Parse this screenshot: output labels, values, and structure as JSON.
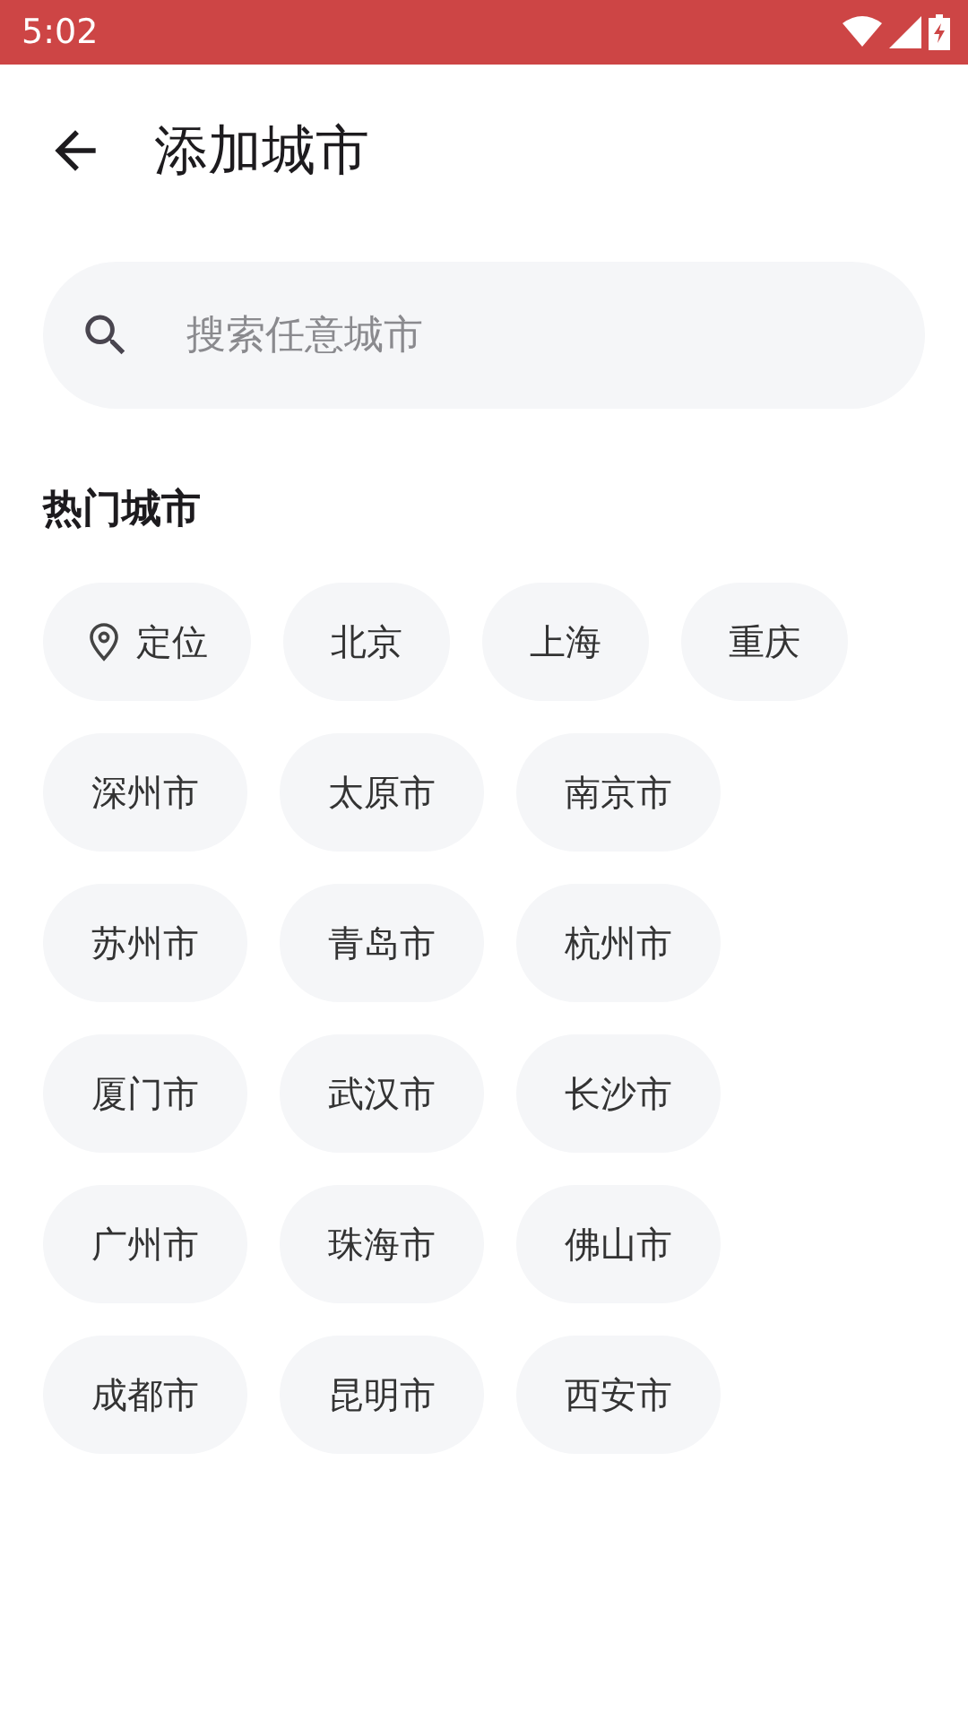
{
  "status_bar": {
    "time": "5:02"
  },
  "header": {
    "title": "添加城市"
  },
  "search": {
    "placeholder": "搜索任意城市"
  },
  "hot_cities": {
    "title": "热门城市",
    "chips": [
      {
        "label": "定位",
        "kind": "location"
      },
      {
        "label": "北京",
        "kind": "city"
      },
      {
        "label": "上海",
        "kind": "city"
      },
      {
        "label": "重庆",
        "kind": "city"
      },
      {
        "label": "深州市",
        "kind": "city"
      },
      {
        "label": "太原市",
        "kind": "city"
      },
      {
        "label": "南京市",
        "kind": "city"
      },
      {
        "label": "苏州市",
        "kind": "city"
      },
      {
        "label": "青岛市",
        "kind": "city"
      },
      {
        "label": "杭州市",
        "kind": "city"
      },
      {
        "label": "厦门市",
        "kind": "city"
      },
      {
        "label": "武汉市",
        "kind": "city"
      },
      {
        "label": "长沙市",
        "kind": "city"
      },
      {
        "label": "广州市",
        "kind": "city"
      },
      {
        "label": "珠海市",
        "kind": "city"
      },
      {
        "label": "佛山市",
        "kind": "city"
      },
      {
        "label": "成都市",
        "kind": "city"
      },
      {
        "label": "昆明市",
        "kind": "city"
      },
      {
        "label": "西安市",
        "kind": "city"
      }
    ]
  }
}
